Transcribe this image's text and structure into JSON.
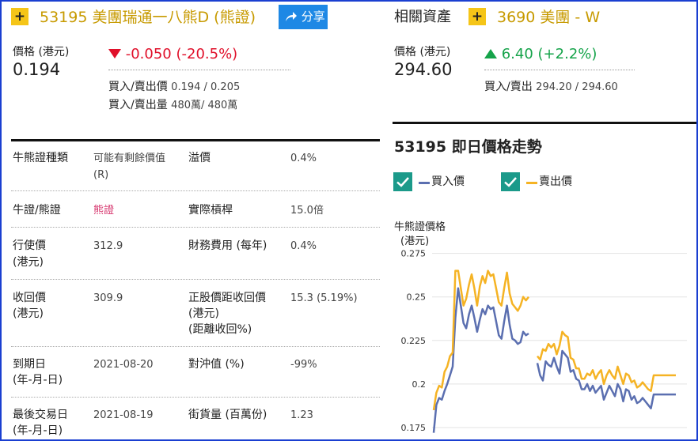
{
  "warrant": {
    "title": "53195 美團瑞通一八熊D",
    "type_tag": "(熊證)",
    "share_label": "分享",
    "price_label": "價格 (港元)",
    "price": "0.194",
    "change": "-0.050 (-20.5%)",
    "bid_ask_label": "買入/賣出價",
    "bid_ask": "0.194 / 0.205",
    "bid_ask_vol_label": "買入/賣出量",
    "bid_ask_vol": "480萬/ 480萬"
  },
  "related": {
    "header": "相關資產",
    "title": "3690 美團 - W",
    "price_label": "價格 (港元)",
    "price": "294.60",
    "change": "6.40 (+2.2%)",
    "bid_ask_label": "買入/賣出",
    "bid_ask": "294.20 / 294.60"
  },
  "details": [
    {
      "k1": "牛熊證種類",
      "v1": "可能有剩餘價值",
      "v1b": "(R)",
      "k2": "溢價",
      "v2": "0.4%"
    },
    {
      "k1": "牛證/熊證",
      "v1": "熊證",
      "k2": "實際槓桿",
      "v2": "15.0倍"
    },
    {
      "k1": "行使價",
      "k1b": "(港元)",
      "v1": "312.9",
      "k2": "財務費用 (每年)",
      "v2": "0.4%"
    },
    {
      "k1": "收回價",
      "k1b": "(港元)",
      "v1": "309.9",
      "k2": "正股價距收回價",
      "k2b": "(港元)",
      "k2c": "(距離收回%)",
      "v2": "15.3 (5.19%)"
    },
    {
      "k1": "到期日",
      "k1b": "(年-月-日)",
      "v1": "2021-08-20",
      "k2": "對沖值 (%)",
      "v2": "-99%"
    },
    {
      "k1": "最後交易日",
      "k1b": "(年-月-日)",
      "v1": "2021-08-19",
      "k2": "街貨量 (百萬份)",
      "v2": "1.23"
    }
  ],
  "chart_section": {
    "title": "53195 即日價格走勢",
    "legend": [
      {
        "label": "買入價",
        "color": "#5b6fb0"
      },
      {
        "label": "賣出價",
        "color": "#f5b324"
      }
    ],
    "ylabel_line1": "牛熊證價格",
    "ylabel_line2": "(港元)"
  },
  "colors": {
    "accent": "#f5c518",
    "down": "#e0102a",
    "up": "#15a34a",
    "share": "#1e88e5",
    "check": "#1b9a8a"
  },
  "icons": {
    "plus": "plus-icon",
    "share": "share-arrow-icon",
    "check": "checkmark-icon",
    "down": "triangle-down-icon",
    "up": "triangle-up-icon"
  },
  "chart_data": {
    "type": "line",
    "title": "53195 即日價格走勢",
    "ylabel": "牛熊證價格 (港元)",
    "ylim": [
      0.17,
      0.278
    ],
    "yticks": [
      "0.275",
      "0.25",
      "0.225",
      "0.2",
      "0.175"
    ],
    "ytick_values": [
      0.275,
      0.25,
      0.225,
      0.2,
      0.175
    ],
    "grid": true,
    "series": [
      {
        "name": "買入價",
        "color": "#5b6fb0",
        "segments": [
          [
            0.172,
            0.188,
            0.192,
            0.191,
            0.196,
            0.2,
            0.205,
            0.21,
            0.238,
            0.255,
            0.245,
            0.235,
            0.232,
            0.24,
            0.245,
            0.238,
            0.23,
            0.237,
            0.243,
            0.24,
            0.245,
            0.243,
            0.244,
            0.236,
            0.228,
            0.226,
            0.236,
            0.245,
            0.234,
            0.226,
            0.225,
            0.223,
            0.224,
            0.23,
            0.228,
            0.229
          ],
          [
            0.212,
            0.205,
            0.202,
            0.213,
            0.211,
            0.21,
            0.215,
            0.21,
            0.206,
            0.219,
            0.217,
            0.215,
            0.207,
            0.208,
            0.203,
            0.202,
            0.197,
            0.197,
            0.2,
            0.196,
            0.199,
            0.195,
            0.197,
            0.199,
            0.191,
            0.195,
            0.199,
            0.196,
            0.193,
            0.2,
            0.197,
            0.19,
            0.197,
            0.196,
            0.191,
            0.193,
            0.189,
            0.19,
            0.192,
            0.19,
            0.188,
            0.186,
            0.194,
            0.194,
            0.194,
            0.194,
            0.194,
            0.194,
            0.194,
            0.194,
            0.194
          ]
        ]
      },
      {
        "name": "賣出價",
        "color": "#f5b324",
        "segments": [
          [
            0.185,
            0.195,
            0.199,
            0.198,
            0.207,
            0.21,
            0.216,
            0.218,
            0.265,
            0.265,
            0.255,
            0.245,
            0.249,
            0.257,
            0.263,
            0.255,
            0.245,
            0.256,
            0.262,
            0.258,
            0.265,
            0.262,
            0.263,
            0.255,
            0.247,
            0.245,
            0.255,
            0.264,
            0.252,
            0.246,
            0.244,
            0.242,
            0.245,
            0.25,
            0.248,
            0.25
          ],
          [
            0.216,
            0.214,
            0.22,
            0.219,
            0.223,
            0.221,
            0.223,
            0.217,
            0.222,
            0.23,
            0.228,
            0.227,
            0.215,
            0.214,
            0.209,
            0.209,
            0.203,
            0.203,
            0.206,
            0.205,
            0.208,
            0.203,
            0.206,
            0.208,
            0.2,
            0.205,
            0.208,
            0.205,
            0.203,
            0.21,
            0.205,
            0.2,
            0.206,
            0.205,
            0.201,
            0.202,
            0.198,
            0.199,
            0.201,
            0.199,
            0.197,
            0.196,
            0.205,
            0.205,
            0.205,
            0.205,
            0.205,
            0.205,
            0.205,
            0.205,
            0.205
          ]
        ]
      }
    ]
  }
}
